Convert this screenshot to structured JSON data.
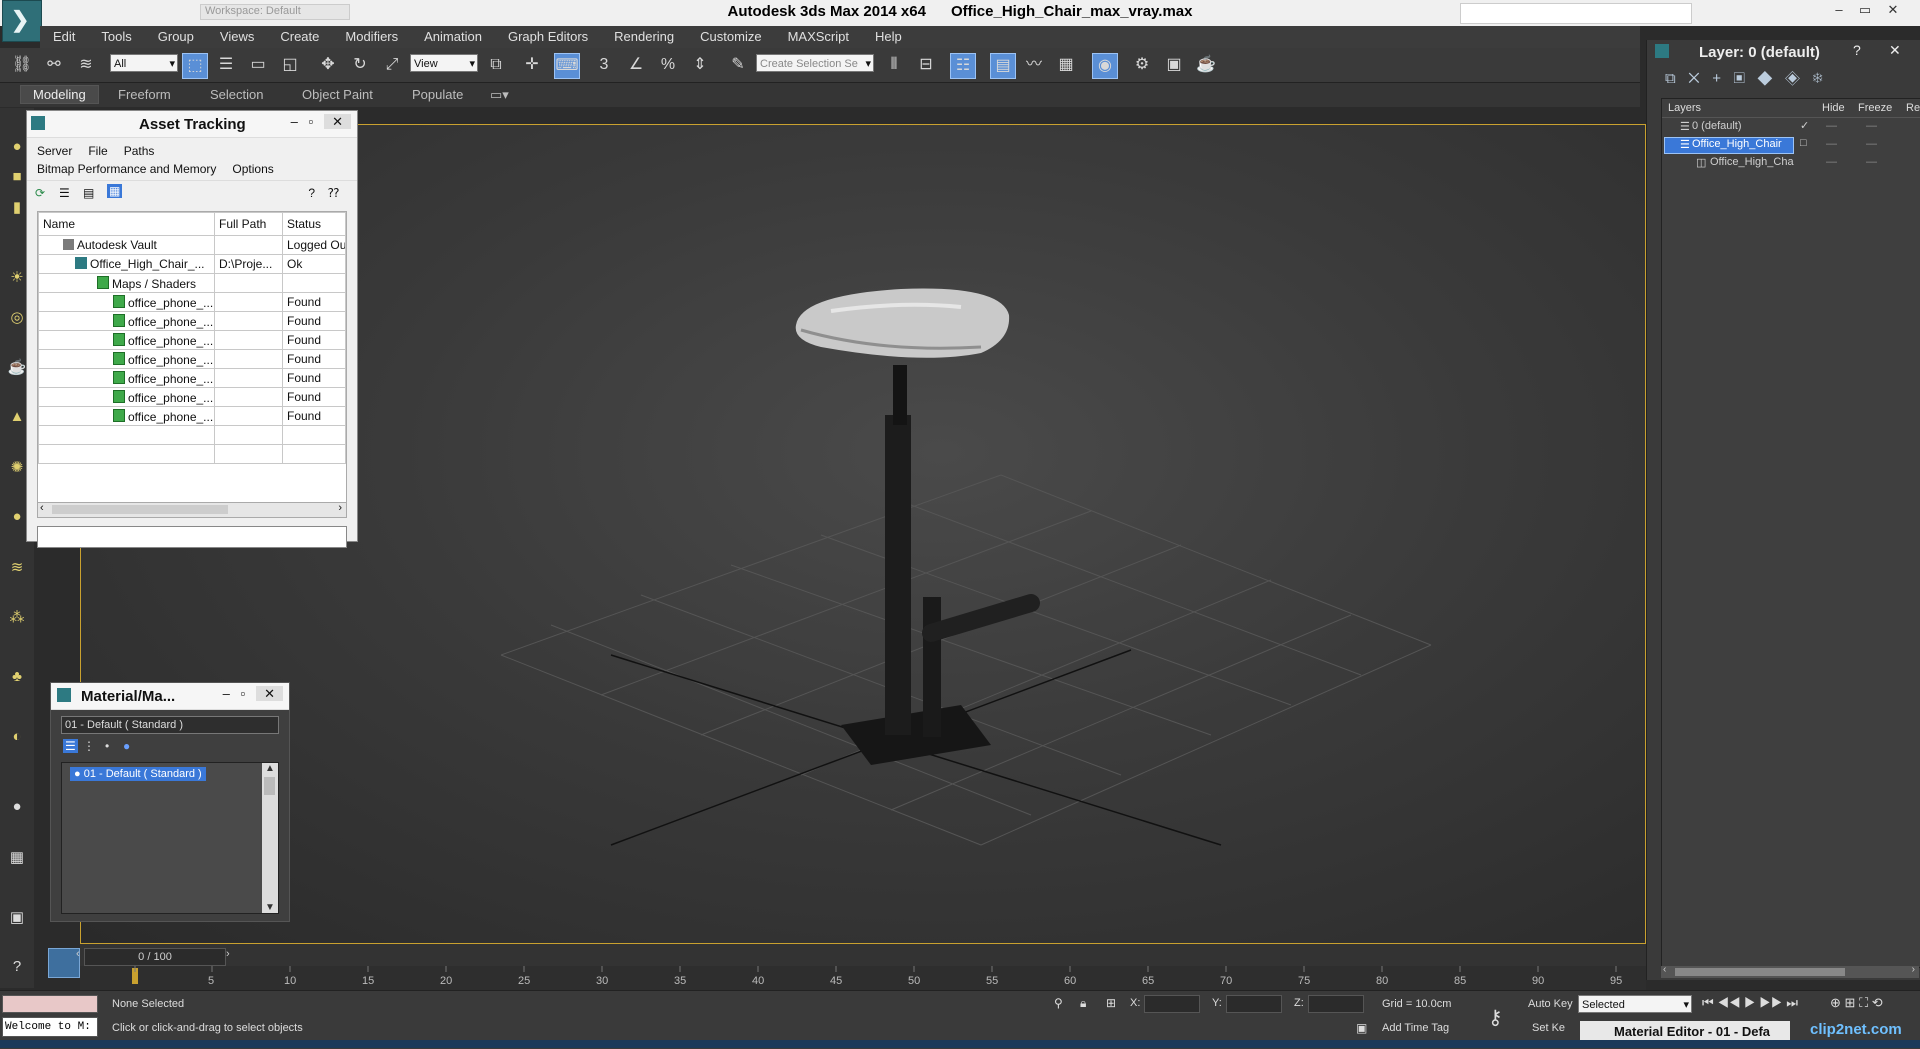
{
  "window": {
    "app_title": "Autodesk 3ds Max  2014 x64",
    "file_title": "Office_High_Chair_max_vray.max",
    "workspace": "Workspace: Default",
    "minimize": "–",
    "maximize": "▭",
    "close": "✕"
  },
  "menu": [
    "Edit",
    "Tools",
    "Group",
    "Views",
    "Create",
    "Modifiers",
    "Animation",
    "Graph Editors",
    "Rendering",
    "Customize",
    "MAXScript",
    "Help"
  ],
  "toolbar": {
    "selection_filter": "All",
    "ref_coord": "View",
    "selection_set_placeholder": "Create Selection Se",
    "snap_3": "3"
  },
  "ribbon_tabs": [
    "Modeling",
    "Freeform",
    "Selection",
    "Object Paint",
    "Populate"
  ],
  "asset_tracking": {
    "title": "Asset Tracking",
    "menus1": [
      "Server",
      "File",
      "Paths"
    ],
    "menus2": [
      "Bitmap Performance and Memory",
      "Options"
    ],
    "columns": [
      "Name",
      "Full Path",
      "Status"
    ],
    "rows": [
      {
        "name": "Autodesk Vault",
        "path": "",
        "status": "Logged Ou"
      },
      {
        "name": "Office_High_Chair_...",
        "path": "D:\\Proje...",
        "status": "Ok"
      },
      {
        "name": "Maps / Shaders",
        "path": "",
        "status": ""
      },
      {
        "name": "office_phone_...",
        "path": "",
        "status": "Found"
      },
      {
        "name": "office_phone_...",
        "path": "",
        "status": "Found"
      },
      {
        "name": "office_phone_...",
        "path": "",
        "status": "Found"
      },
      {
        "name": "office_phone_...",
        "path": "",
        "status": "Found"
      },
      {
        "name": "office_phone_...",
        "path": "",
        "status": "Found"
      },
      {
        "name": "office_phone_...",
        "path": "",
        "status": "Found"
      },
      {
        "name": "office_phone_...",
        "path": "",
        "status": "Found"
      }
    ]
  },
  "material_editor": {
    "title": "Material/Ma...",
    "material_name": "01 - Default  ( Standard )",
    "list_item": "01 - Default  ( Standard )"
  },
  "layers": {
    "title": "Layer: 0 (default)",
    "help": "?",
    "columns": [
      "Layers",
      "Hide",
      "Freeze",
      "Re"
    ],
    "rows": [
      {
        "name": "0 (default)",
        "selected": false,
        "checked": true
      },
      {
        "name": "Office_High_Chair",
        "selected": true,
        "checked": false
      },
      {
        "name": "Office_High_Cha",
        "selected": false,
        "checked": false
      }
    ]
  },
  "timeline": {
    "frame_counter": "0 / 100",
    "ticks": [
      "5",
      "10",
      "15",
      "20",
      "25",
      "30",
      "35",
      "40",
      "45",
      "50",
      "55",
      "60",
      "65",
      "70",
      "75",
      "80",
      "85",
      "90",
      "95"
    ]
  },
  "status": {
    "selection": "None Selected",
    "prompt": "Click or click-and-drag to select objects",
    "maxscript": "Welcome to M:",
    "x_label": "X:",
    "y_label": "Y:",
    "z_label": "Z:",
    "grid": "Grid = 10.0cm",
    "add_time_tag": "Add Time Tag",
    "auto_key": "Auto Key",
    "set_key": "Set Ke",
    "key_filter": "Selected"
  },
  "taskbar": {
    "material_editor_task": "Material Editor - 01 - Defa",
    "watermark": "clip2net.com"
  },
  "colors": {
    "viewport_border": "#c9a12f",
    "selection_blue": "#3a78d8",
    "found_icon": "#3fa94a"
  }
}
